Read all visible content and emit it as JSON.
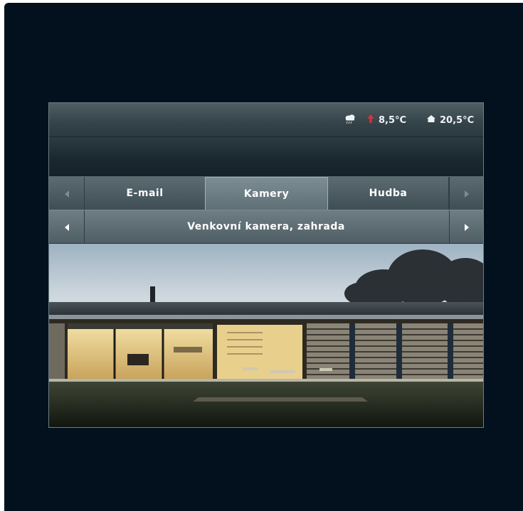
{
  "status": {
    "weather_icon": "rain-cloud-icon",
    "outdoor_trend_icon": "up-arrow-icon",
    "outdoor_temp": "8,5°C",
    "indoor_icon": "house-icon",
    "indoor_temp": "20,5°C"
  },
  "tabs": {
    "items": [
      {
        "label": "E-mail"
      },
      {
        "label": "Kamery",
        "active": true
      },
      {
        "label": "Hudba"
      }
    ]
  },
  "camera": {
    "title": "Venkovní kamera, zahrada"
  },
  "colors": {
    "device_bg": "#02111d",
    "trend_arrow": "#d9323a",
    "text": "#ffffff"
  }
}
